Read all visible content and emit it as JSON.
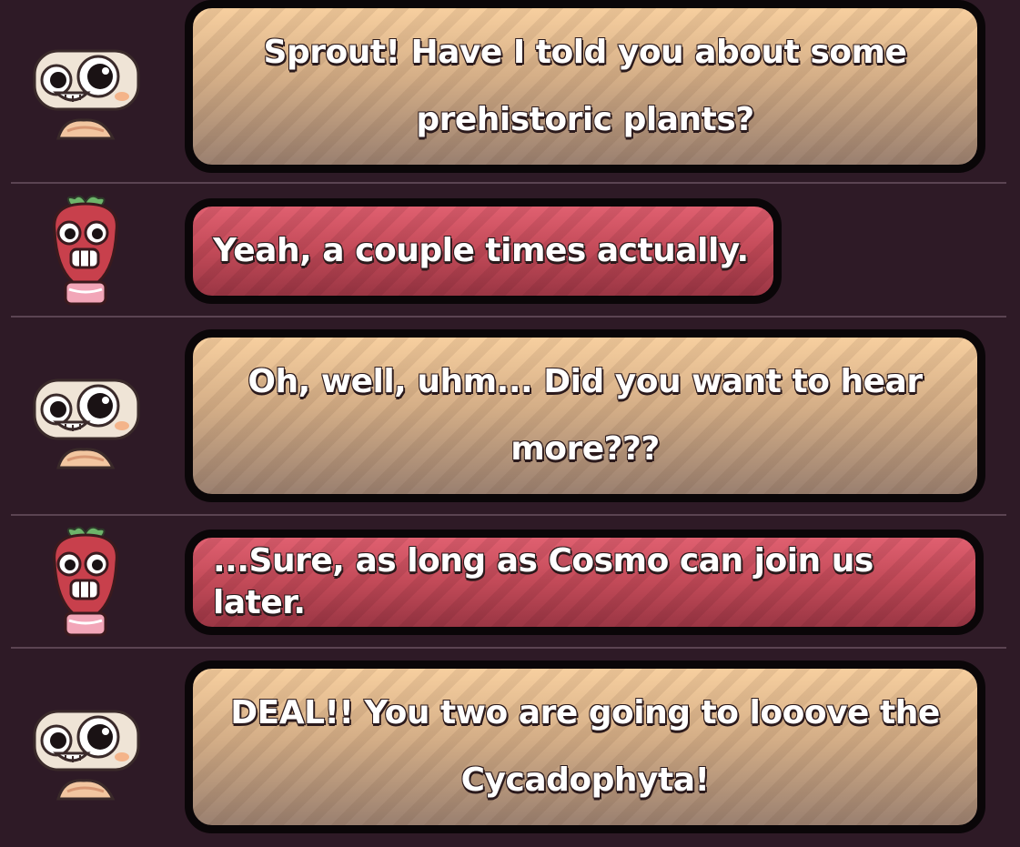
{
  "messages": [
    {
      "speaker": "cosmo",
      "text": "Sprout! Have I told you about some prehistoric plants?"
    },
    {
      "speaker": "sprout",
      "text": "Yeah, a couple times actually."
    },
    {
      "speaker": "cosmo",
      "text": "Oh, well, uhm... Did you want to hear more???"
    },
    {
      "speaker": "sprout",
      "text": "...Sure, as long as Cosmo can join us later."
    },
    {
      "speaker": "cosmo",
      "text": "DEAL!! You two are going to looove the Cycadophyta!"
    }
  ],
  "colors": {
    "background": "#2e1a26",
    "cosmo_bubble": "#d4ae87",
    "sprout_bubble": "#c24a58",
    "bubble_border": "#0a0608"
  }
}
